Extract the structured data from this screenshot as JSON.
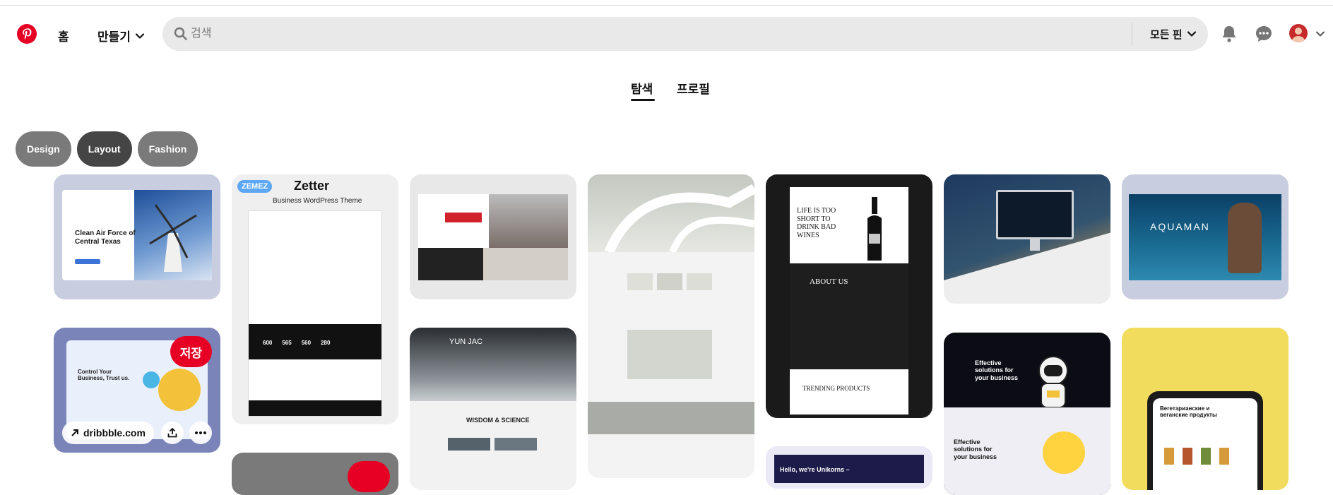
{
  "header": {
    "home_label": "홈",
    "create_label": "만들기",
    "search_placeholder": "검색",
    "search_scope": "모든 핀"
  },
  "tabs": [
    {
      "label": "탐색",
      "active": true
    },
    {
      "label": "프로필",
      "active": false
    }
  ],
  "chips": [
    "Design",
    "Layout",
    "Fashion"
  ],
  "pins": {
    "zetter_brand": "ZEMEZ",
    "zetter_title": "Zetter",
    "zetter_subtitle": "Business WordPress Theme",
    "zetter_counts": [
      "600",
      "565",
      "560",
      "280"
    ],
    "clean_air": "Clean Air Force of Central Texas",
    "wine_headline": "LIFE IS TOO SHORT TO DRINK BAD WINES",
    "wine_about": "ABOUT US",
    "wine_trending": "TRENDING PRODUCTS",
    "aquaman": "AQUAMAN",
    "yunjac": "YUN JAC",
    "yunjac_sub": "WISDOM & SCIENCE",
    "astronaut_text": "Effective solutions for your business",
    "astronaut_text_2": "Effective solutions for your business",
    "unikorns": "Hello, we're Unikorns –",
    "grocery": "Вегетарианские и веганские продукты",
    "save_label": "저장",
    "source_link": "dribbble.com",
    "control_text": "Control Your Business, Trust us."
  },
  "colors": {
    "brand_red": "#e60023",
    "search_bg": "#e9e9e9"
  }
}
